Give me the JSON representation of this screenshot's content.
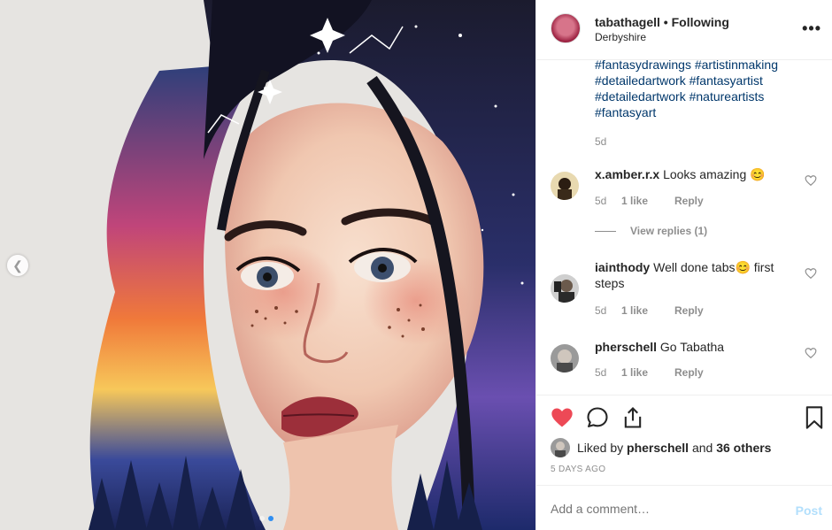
{
  "post": {
    "username": "tabathagell",
    "follow_status": "Following",
    "separator": "•",
    "location": "Derbyshire",
    "more_icon": "more-icon",
    "more_glyph": "•••"
  },
  "caption": {
    "tags": [
      "#fantasydrawings #artistinmaking",
      "#detailedartwork #fantasyartist",
      "#detailedartwork #natureartists",
      "#fantasyart"
    ],
    "time": "5d"
  },
  "comments": [
    {
      "user": "x.amber.r.x",
      "text": "Looks amazing 😊",
      "time": "5d",
      "likes": "1 like",
      "reply": "Reply"
    },
    {
      "user": "iainthody",
      "text": "Well done tabs😊 first steps",
      "time": "5d",
      "likes": "1 like",
      "reply": "Reply"
    },
    {
      "user": "pherschell",
      "text": "Go Tabatha",
      "time": "5d",
      "likes": "1 like",
      "reply": "Reply"
    }
  ],
  "view_replies": "View replies (1)",
  "likes": {
    "prefix": "Liked by",
    "user": "pherschell",
    "and": "and",
    "others": "36 others"
  },
  "timestamp": "5 DAYS AGO",
  "add_comment": {
    "placeholder": "Add a comment…",
    "post_label": "Post"
  },
  "colors": {
    "heart": "#ed4956",
    "link": "#00376b",
    "muted": "#8e8e8e",
    "post_disabled": "#b2dffc"
  }
}
